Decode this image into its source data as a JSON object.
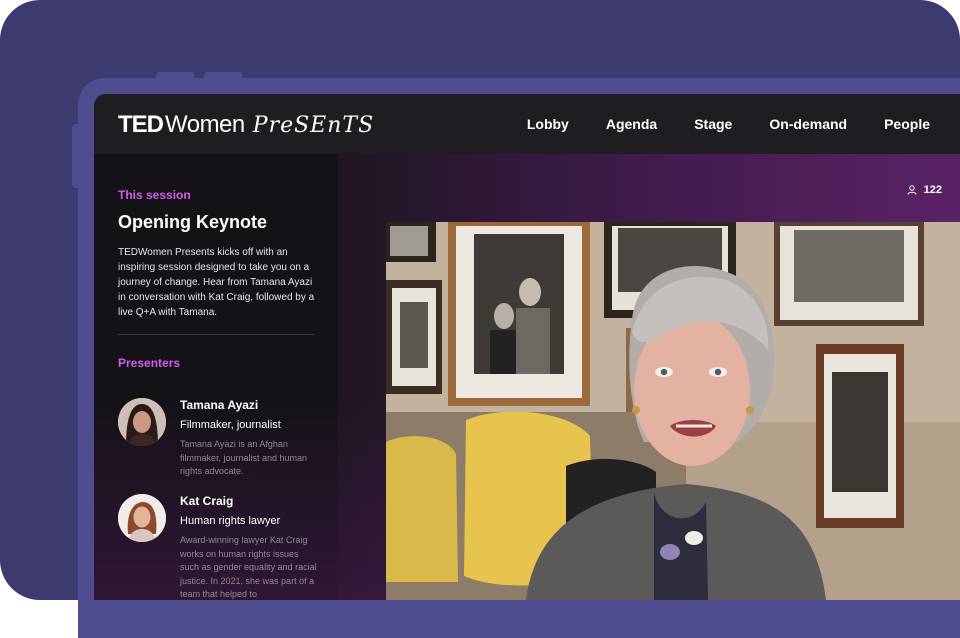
{
  "header": {
    "logo": {
      "ted": "TED",
      "women": "Women",
      "presents": "PreSEnTS"
    },
    "nav": [
      "Lobby",
      "Agenda",
      "Stage",
      "On-demand",
      "People"
    ]
  },
  "session": {
    "kicker": "This session",
    "title": "Opening Keynote",
    "description": "TEDWomen Presents kicks off with an inspiring session designed to take you on a journey of change. Hear from Tamana Ayazi in conversation with Kat Craig, followed by a live Q+A with Tamana."
  },
  "viewers": {
    "count": "122",
    "icon": "person-icon"
  },
  "presenters": {
    "kicker": "Presenters",
    "items": [
      {
        "name": "Tamana Ayazi",
        "role": "Filmmaker, journalist",
        "bio": "Tamana Ayazi is an Afghan filmmaker, journalist and human rights advocate."
      },
      {
        "name": "Kat Craig",
        "role": "Human rights lawyer",
        "bio": "Award-winning lawyer Kat Craig works on human rights issues such as gender equality and racial justice. In 2021, she was part of a team that helped to"
      }
    ]
  },
  "colors": {
    "accent": "#d65cf0",
    "frame": "#3c3a6e",
    "device": "#4f4d90",
    "header_bg": "#1f1d22",
    "screen_bg": "#141216"
  }
}
